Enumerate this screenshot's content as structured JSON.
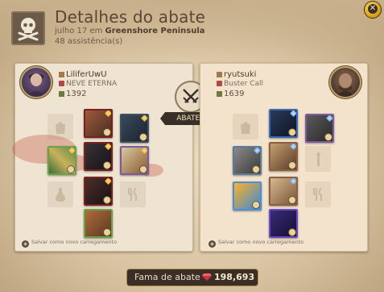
{
  "header": {
    "title": "Detalhes do abate",
    "date": "julho 17",
    "location_prefix": "em",
    "location": "Greenshore Peninsula",
    "assists": "48 assistência(s)",
    "close_icon": "close-x-icon"
  },
  "center": {
    "label": "ABATEU",
    "icon": "crossed-swords-icon"
  },
  "killer": {
    "name": "LiliferUwU",
    "guild": "NEVE ETERNA",
    "item_power": "1392",
    "save_label": "Salvar como novo carregamento"
  },
  "victim": {
    "name": "ryutsuki",
    "guild": "Buster Call",
    "item_power": "1639",
    "save_label": "Salvar como novo carregamento"
  },
  "footer": {
    "fame_label": "Fama de abate",
    "fame_value": "198,693"
  },
  "colors": {
    "panel_left": "#eee4d1",
    "panel_right": "#f3e2cc",
    "dark_label": "#3a2f27",
    "accent_gold": "#d19a10"
  }
}
